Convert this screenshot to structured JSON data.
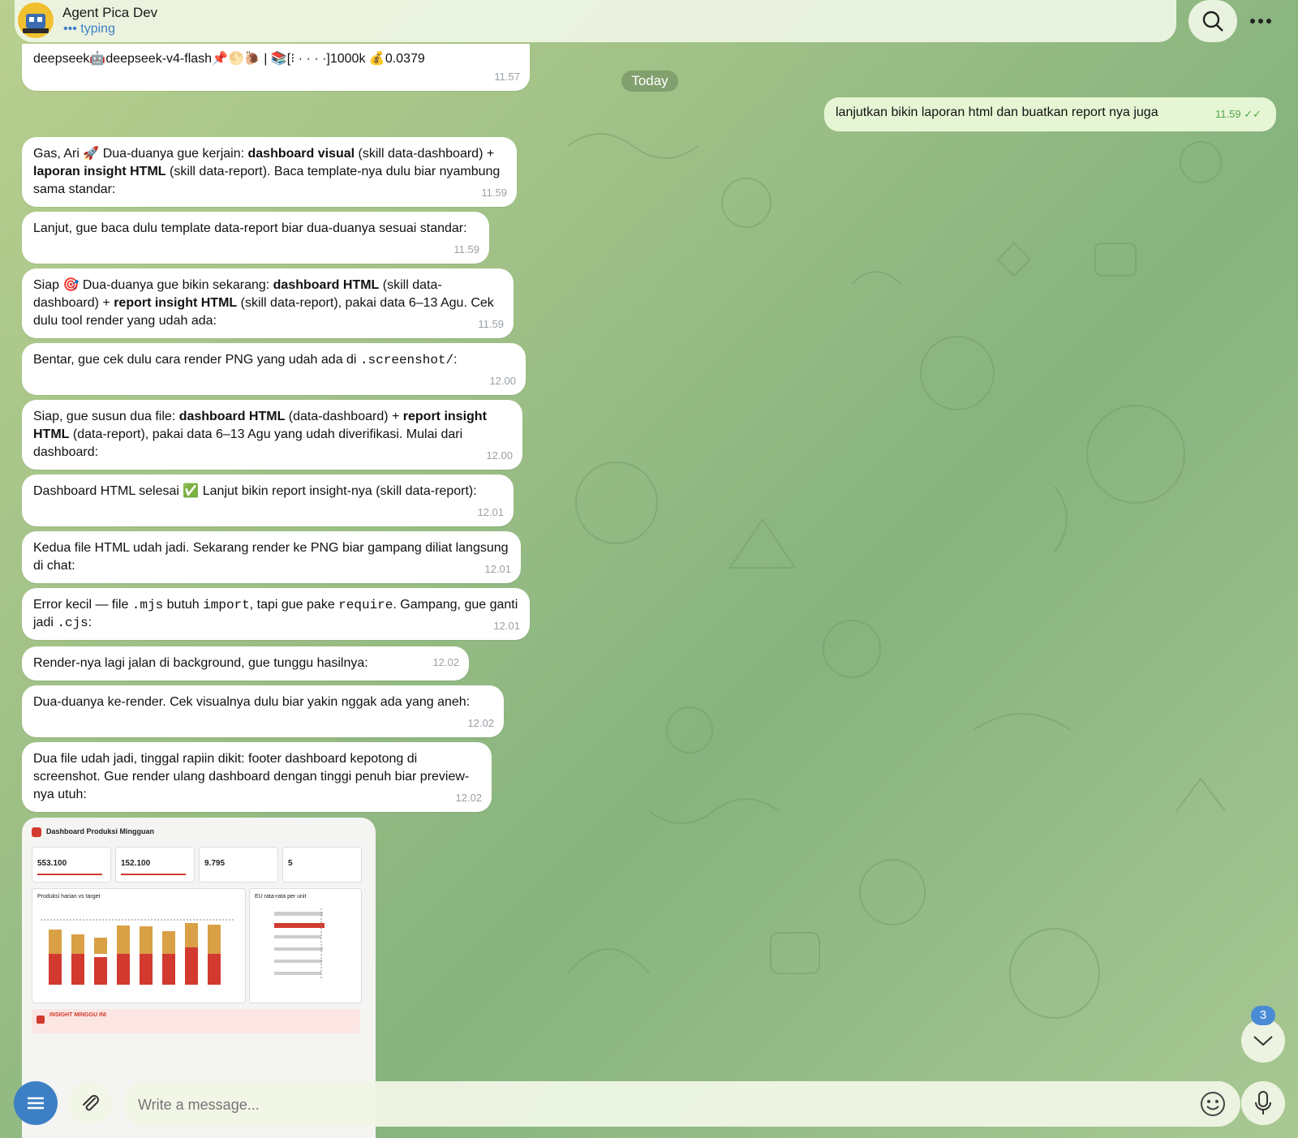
{
  "header": {
    "title": "Agent Pica Dev",
    "status": "typing"
  },
  "top_message": {
    "text": "deepseek🤖deepseek-v4-flash📌🌕🐌 | 📚[⁝ · · · ·]1000k 💰0.0379",
    "time": "11.57"
  },
  "day_badge": "Today",
  "outgoing": {
    "text": "lanjutkan bikin laporan html dan buatkan report nya juga",
    "time": "11.59"
  },
  "messages": [
    {
      "p1": "Gas, Ari 🚀 Dua-duanya gue kerjain: ",
      "b1": "dashboard visual",
      "p2": " (skill data-dashboard) + ",
      "b2": "laporan insight HTML",
      "p3": " (skill data-report). Baca template-nya dulu biar nyambung sama standar:",
      "time": "11.59"
    },
    {
      "p1": "Lanjut, gue baca dulu template data-report biar dua-duanya sesuai standar:",
      "time": "11.59"
    },
    {
      "p1": "Siap 🎯 Dua-duanya gue bikin sekarang: ",
      "b1": "dashboard HTML",
      "p2": " (skill data-dashboard) + ",
      "b2": "report insight HTML",
      "p3": " (skill data-report), pakai data 6–13 Agu. Cek dulu tool render yang udah ada:",
      "time": "11.59"
    },
    {
      "p1": "Bentar, gue cek dulu cara render PNG yang udah ada di ",
      "m1": ".screenshot/",
      "p2": ":",
      "time": "12.00"
    },
    {
      "p1": "Siap, gue susun dua file: ",
      "b1": "dashboard HTML",
      "p2": " (data-dashboard) + ",
      "b2": "report insight HTML",
      "p3": " (data-report), pakai data 6–13 Agu yang udah diverifikasi. Mulai dari dashboard:",
      "time": "12.00"
    },
    {
      "p1": "Dashboard HTML selesai ✅ Lanjut bikin report insight-nya (skill data-report):",
      "time": "12.01"
    },
    {
      "p1": "Kedua file HTML udah jadi. Sekarang render ke PNG biar gampang diliat langsung di chat:",
      "time": "12.01"
    },
    {
      "p1": "Error kecil — file ",
      "m1": ".mjs",
      "p2": " butuh ",
      "m2": "import",
      "p3": ", tapi gue pake ",
      "m3": "require",
      "p4": ". Gampang, gue ganti jadi ",
      "m4": ".cjs",
      "p5": ":",
      "time": "12.01"
    },
    {
      "p1": "Render-nya lagi jalan di background, gue tunggu hasilnya:",
      "time": "12.02"
    },
    {
      "p1": "Dua-duanya ke-render. Cek visualnya dulu biar yakin nggak ada yang aneh:",
      "time": "12.02"
    },
    {
      "p1": "Dua file udah jadi, tinggal rapiin dikit: footer dashboard kepotong di screenshot. Gue render ulang dashboard dengan tinggi penuh biar preview-nya utuh:",
      "time": "12.02"
    }
  ],
  "preview": {
    "title": "Dashboard Produksi Mingguan",
    "kpis": [
      "553.100",
      "152.100",
      "9.795",
      "5"
    ],
    "chart1_title": "Produksi harian vs target",
    "chart2_title": "EU rata-rata per unit",
    "insight": "INSIGHT MINGGU INI"
  },
  "composer": {
    "placeholder": "Write a message..."
  },
  "scroll_badge": "3",
  "colors": {
    "accent": "#3d7fc4",
    "outgoing_bg": "#e6f6d4",
    "check": "#55a44b"
  }
}
